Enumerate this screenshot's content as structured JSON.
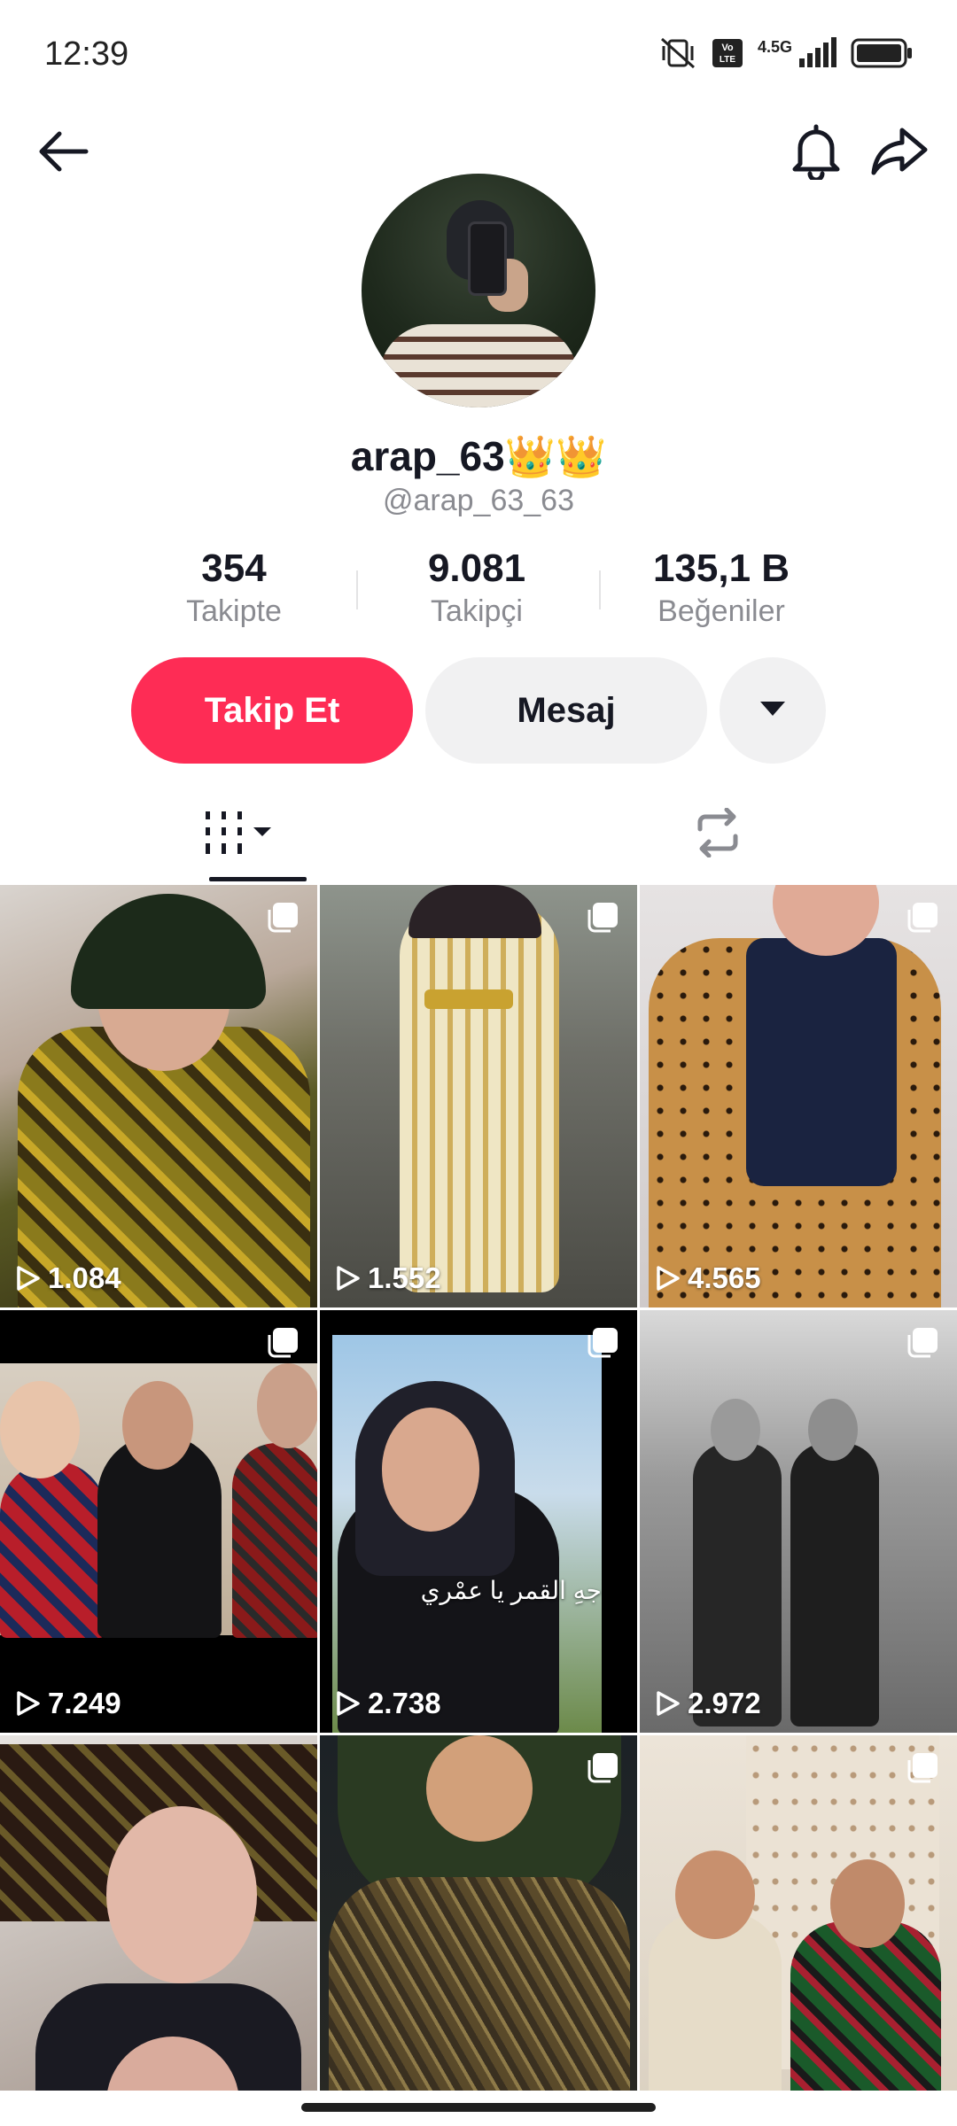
{
  "status_bar": {
    "time": "12:39",
    "network": "4.5G",
    "volte": "Vo LTE",
    "icons": [
      "mute-vibrate-icon",
      "volte-icon",
      "signal-icon",
      "battery-icon"
    ]
  },
  "nav": {
    "back_icon": "arrow-left-icon",
    "bell_icon": "bell-icon",
    "share_icon": "share-arrow-icon"
  },
  "profile": {
    "username": "arap_63👑👑",
    "handle": "@arap_63_63"
  },
  "stats": [
    {
      "value": "354",
      "label": "Takipte"
    },
    {
      "value": "9.081",
      "label": "Takipçi"
    },
    {
      "value": "135,1 B",
      "label": "Beğeniler"
    }
  ],
  "actions": {
    "follow_label": "Takip Et",
    "message_label": "Mesaj",
    "more_icon": "caret-down-icon"
  },
  "tabs": [
    {
      "name": "videos",
      "icon": "grid-bars-icon",
      "active": true
    },
    {
      "name": "reposts",
      "icon": "repost-icon",
      "active": false
    }
  ],
  "videos": [
    {
      "views": "1.084",
      "caption": ""
    },
    {
      "views": "1.552",
      "caption": ""
    },
    {
      "views": "4.565",
      "caption": ""
    },
    {
      "views": "7.249",
      "caption": ""
    },
    {
      "views": "2.738",
      "caption": "جهِ القمر يا عمْري"
    },
    {
      "views": "2.972",
      "caption": ""
    },
    {
      "views": "",
      "caption": ""
    },
    {
      "views": "",
      "caption": ""
    },
    {
      "views": "",
      "caption": ""
    }
  ],
  "colors": {
    "accent": "#fe2c55",
    "secondary_button": "#f1f1f2",
    "text_primary": "#161823",
    "text_secondary": "#8a8b91"
  }
}
